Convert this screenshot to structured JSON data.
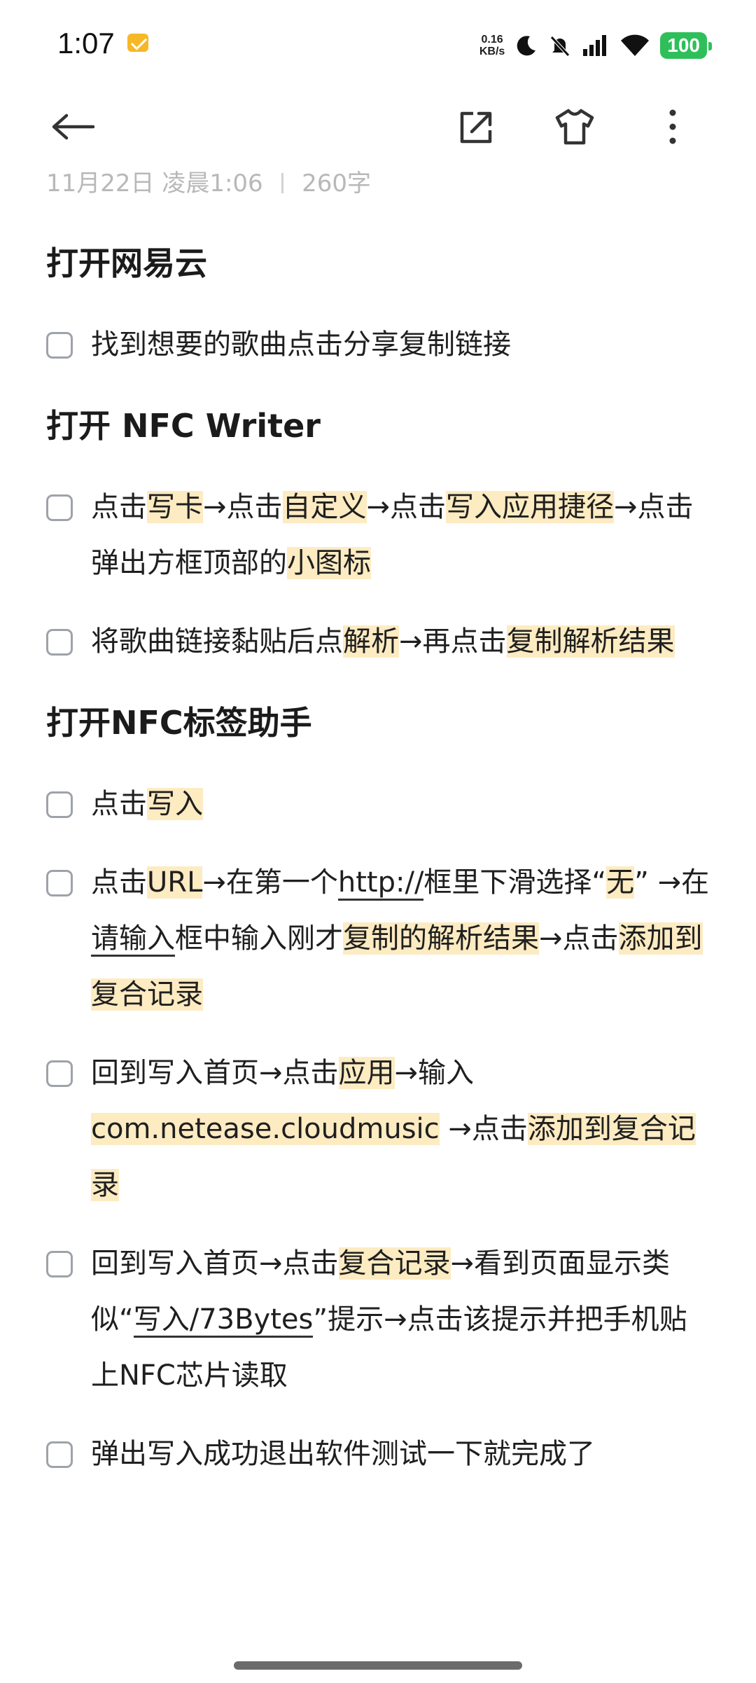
{
  "status": {
    "time": "1:07",
    "net_speed_top": "0.16",
    "net_speed_bottom": "KB/s",
    "battery": "100"
  },
  "meta": {
    "date": "11月22日 凌晨1:06",
    "divider": "|",
    "count": "260字"
  },
  "toolbar": {
    "back": "back-arrow-icon",
    "share": "share-icon",
    "theme": "shirt-icon",
    "more": "more-icon"
  },
  "sections": {
    "h1": "打开网易云",
    "h2": "打开 NFC Writer",
    "h3": "打开NFC标签助手"
  },
  "items": {
    "i1": {
      "t": "找到想要的歌曲点击分享复制链接"
    },
    "i2": {
      "a": "点击",
      "b": "写卡",
      "c": "→点击",
      "d": "自定义",
      "e": "→点击",
      "f": "写入应用捷径",
      "g": "→点击弹出方框顶部的",
      "h": "小图标"
    },
    "i3": {
      "a": "将歌曲链接黏贴后点",
      "b": "解析",
      "c": "→再点击",
      "d": "复制解析结果"
    },
    "i4": {
      "a": "点击",
      "b": "写入"
    },
    "i5": {
      "a": "点击",
      "b": "URL",
      "c": "→在第一个",
      "d": "http://",
      "e": "框里下滑选择“",
      "f": "无",
      "g": "” →在",
      "h": "请输入",
      "i": "框中输入刚才",
      "j": "复制的解析结果",
      "k": "→点击",
      "l": "添加到复合记录"
    },
    "i6": {
      "a": "回到写入首页→点击",
      "b": "应用",
      "c": "→输入",
      "d": "com.netease.cloudmusic",
      "e": " →点击",
      "f": "添加到复合记录"
    },
    "i7": {
      "a": "回到写入首页→点击",
      "b": "复合记录",
      "c": "→看到页面显示类似“",
      "d": "写入/73Bytes",
      "e": "”提示→点击该提示并把手机贴上NFC芯片读取"
    },
    "i8": {
      "t": "弹出写入成功退出软件测试一下就完成了"
    }
  }
}
